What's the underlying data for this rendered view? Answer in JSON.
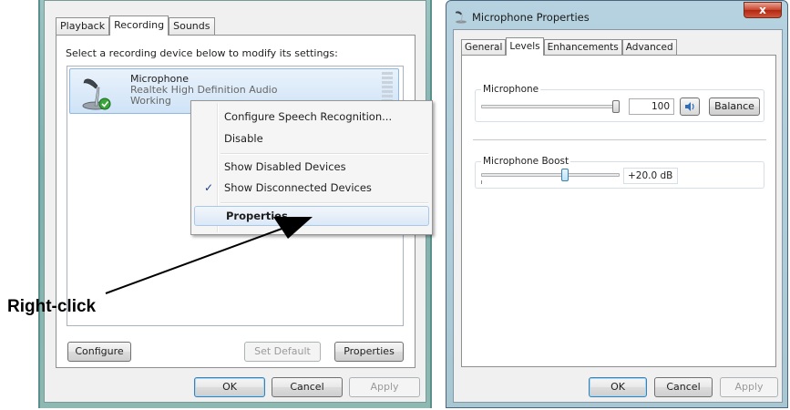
{
  "sound_dialog": {
    "tabs": [
      {
        "label": "Playback"
      },
      {
        "label": "Recording"
      },
      {
        "label": "Sounds"
      }
    ],
    "instruction": "Select a recording device below to modify its settings:",
    "device": {
      "name": "Microphone",
      "driver": "Realtek High Definition Audio",
      "status": "Working"
    },
    "buttons": {
      "configure": "Configure",
      "set_default": "Set Default",
      "properties": "Properties",
      "ok": "OK",
      "cancel": "Cancel",
      "apply": "Apply"
    }
  },
  "context_menu": {
    "items": [
      {
        "label": "Configure Speech Recognition..."
      },
      {
        "label": "Disable"
      },
      {
        "label": "Show Disabled Devices"
      },
      {
        "label": "Show Disconnected Devices",
        "checked": true
      },
      {
        "label": "Properties",
        "highlighted": true
      }
    ]
  },
  "annotation": {
    "label": "Right-click"
  },
  "mic_properties": {
    "title": "Microphone Properties",
    "close_glyph": "x",
    "tabs": [
      {
        "label": "General"
      },
      {
        "label": "Levels"
      },
      {
        "label": "Enhancements"
      },
      {
        "label": "Advanced"
      }
    ],
    "microphone": {
      "label": "Microphone",
      "level": 100,
      "level_text": "100",
      "balance_label": "Balance"
    },
    "boost": {
      "label": "Microphone Boost",
      "value_text": "+20.0 dB"
    },
    "buttons": {
      "ok": "OK",
      "cancel": "Cancel",
      "apply": "Apply"
    }
  }
}
